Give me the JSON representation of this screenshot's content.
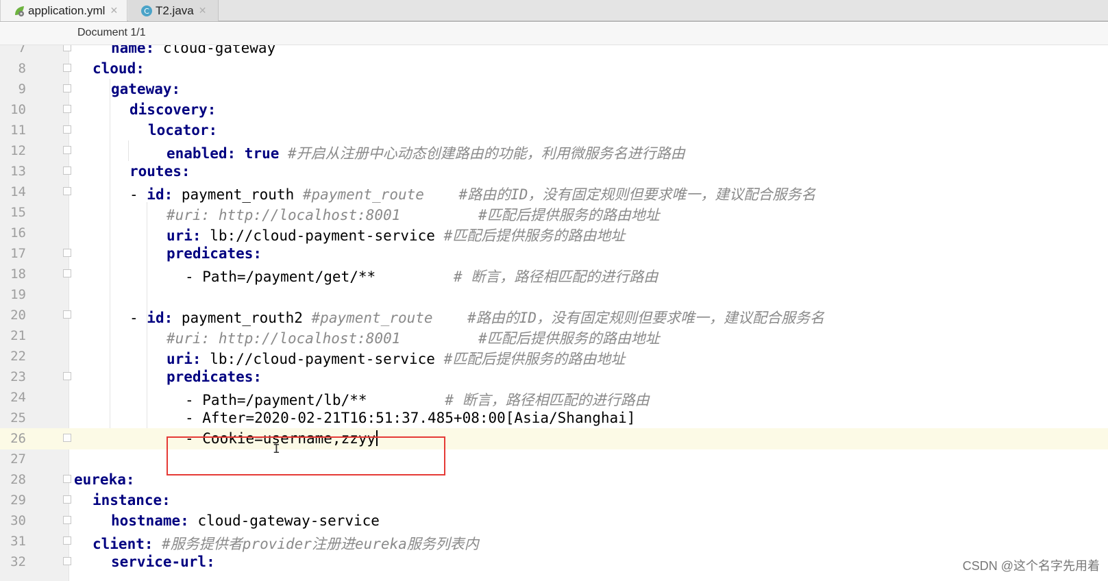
{
  "tabs": [
    {
      "label": "application.yml",
      "icon": "yaml-leaf-icon"
    },
    {
      "label": "T2.java",
      "icon": "java-class-icon"
    }
  ],
  "breadcrumb": "Document 1/1",
  "lines": [
    {
      "n": "7",
      "indent": 2,
      "key": "name:",
      "val": " cloud-gateway"
    },
    {
      "n": "8",
      "indent": 1,
      "key": "cloud:"
    },
    {
      "n": "9",
      "indent": 2,
      "key": "gateway:"
    },
    {
      "n": "10",
      "indent": 3,
      "key": "discovery:"
    },
    {
      "n": "11",
      "indent": 4,
      "key": "locator:"
    },
    {
      "n": "12",
      "indent": 5,
      "key": "enabled:",
      "bold": " true",
      "comment": " #开启从注册中心动态创建路由的功能，利用微服务名进行路由"
    },
    {
      "n": "13",
      "indent": 3,
      "key": "routes:"
    },
    {
      "n": "14",
      "indent": 4,
      "dash": "- ",
      "key": "id:",
      "val": " payment_routh ",
      "comment": "#payment_route    #路由的ID，没有固定规则但要求唯一，建议配合服务名"
    },
    {
      "n": "15",
      "indent": 5,
      "comment": "#uri: http://localhost:8001         #匹配后提供服务的路由地址"
    },
    {
      "n": "16",
      "indent": 5,
      "key": "uri:",
      "val": " lb://cloud-payment-service ",
      "comment": "#匹配后提供服务的路由地址"
    },
    {
      "n": "17",
      "indent": 5,
      "key": "predicates:"
    },
    {
      "n": "18",
      "indent": 6,
      "val": "- Path=/payment/get/**         ",
      "comment": "# 断言，路径相匹配的进行路由"
    },
    {
      "n": "19",
      "indent": 0
    },
    {
      "n": "20",
      "indent": 4,
      "dash": "- ",
      "key": "id:",
      "val": " payment_routh2 ",
      "comment": "#payment_route    #路由的ID，没有固定规则但要求唯一，建议配合服务名"
    },
    {
      "n": "21",
      "indent": 5,
      "comment": "#uri: http://localhost:8001         #匹配后提供服务的路由地址"
    },
    {
      "n": "22",
      "indent": 5,
      "key": "uri:",
      "val": " lb://cloud-payment-service ",
      "comment": "#匹配后提供服务的路由地址"
    },
    {
      "n": "23",
      "indent": 5,
      "key": "predicates:"
    },
    {
      "n": "24",
      "indent": 6,
      "val": "- Path=/payment/lb/**         ",
      "comment": "# 断言，路径相匹配的进行路由"
    },
    {
      "n": "25",
      "indent": 6,
      "val": "- After=2020-02-21T16:51:37.485+08:00[Asia/Shanghai]"
    },
    {
      "n": "26",
      "indent": 6,
      "val": "- Cookie=username,zzyy",
      "current": true
    },
    {
      "n": "27",
      "indent": 0
    },
    {
      "n": "28",
      "indent": 0,
      "key": "eureka:"
    },
    {
      "n": "29",
      "indent": 1,
      "key": "instance:"
    },
    {
      "n": "30",
      "indent": 2,
      "key": "hostname:",
      "val": " cloud-gateway-service"
    },
    {
      "n": "31",
      "indent": 1,
      "key": "client:",
      "comment": " #服务提供者provider注册进eureka服务列表内"
    },
    {
      "n": "32",
      "indent": 2,
      "key": "service-url:"
    }
  ],
  "watermark": "CSDN @这个名字先用着"
}
